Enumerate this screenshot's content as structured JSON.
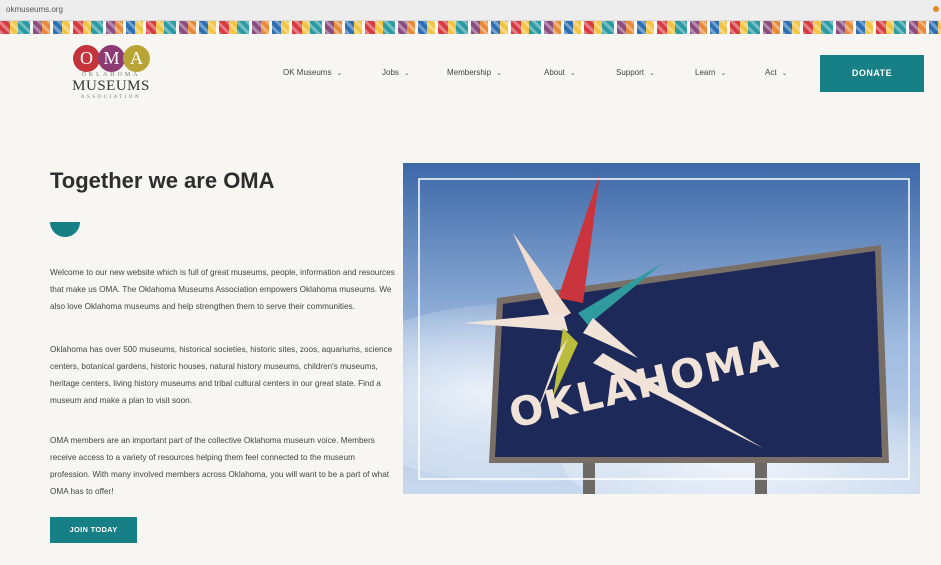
{
  "browser": {
    "url": "okmuseums.org"
  },
  "logo": {
    "letters": [
      "O",
      "M",
      "A"
    ],
    "line1": "OKLAHOMA",
    "line2": "MUSEUMS",
    "line3": "ASSOCIATION"
  },
  "nav": {
    "items": [
      {
        "label": "OK Museums"
      },
      {
        "label": "Jobs"
      },
      {
        "label": "Membership"
      },
      {
        "label": "About"
      },
      {
        "label": "Support"
      },
      {
        "label": "Learn"
      },
      {
        "label": "Act"
      }
    ],
    "donate_label": "DONATE"
  },
  "hero": {
    "title": "Together we are OMA",
    "paragraphs": [
      "Welcome to our new website which is full of great museums, people, information and resources that make us OMA. The Oklahoma Museums Association empowers Oklahoma museums. We also love Oklahoma museums and help strengthen them to serve their communities.",
      "Oklahoma has over 500 museums, historical societies, historic sites, zoos, aquariums, science centers, botanical gardens, historic houses, natural history museums, children's museums, heritage centers, living history museums and tribal cultural centers in our great state. Find a museum and make a plan to visit soon.",
      "OMA members are an important part of the collective Oklahoma museum voice. Members receive access to a variety of resources helping them feel connected to the museum profession. With many involved members across Oklahoma, you will want to be a part of what OMA has to offer!"
    ],
    "join_label": "JOIN TODAY",
    "sign_text": "OKLAHOMA"
  },
  "colors": {
    "brand_teal": "#177f86",
    "logo_red": "#c4343b",
    "logo_purple": "#8d3c73",
    "logo_gold": "#b9a535"
  }
}
